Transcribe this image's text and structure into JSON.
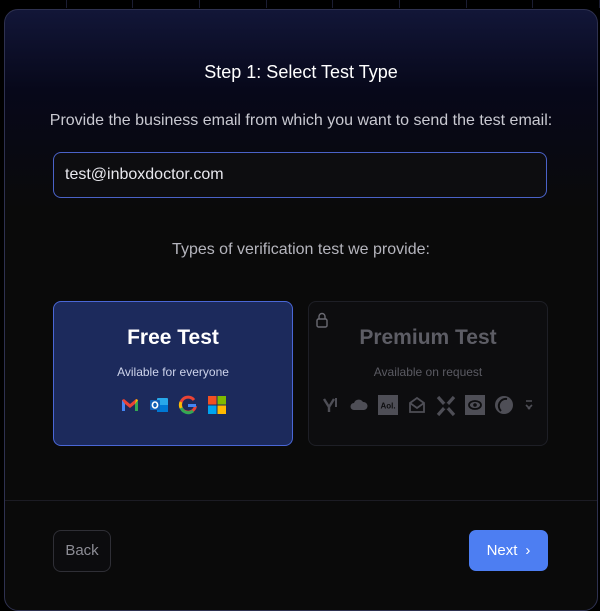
{
  "header": {
    "title": "Step 1: Select Test Type"
  },
  "email": {
    "prompt": "Provide the business email from which you want to send the test email:",
    "value": "test@inboxdoctor.com"
  },
  "test_types": {
    "heading": "Types of verification test we provide:",
    "free": {
      "name": "Free Test",
      "description": "Avilable for everyone",
      "selected": true,
      "providers": [
        "gmail-icon",
        "outlook-icon",
        "google-icon",
        "microsoft-icon"
      ]
    },
    "premium": {
      "name": "Premium Test",
      "description": "Available on request",
      "locked": true,
      "aol_label": "Aol.",
      "providers": [
        "yahoo-icon",
        "icloud-icon",
        "aol-icon",
        "mailbox-icon",
        "x-icon",
        "yandex-icon",
        "opera-icon",
        "other-icon"
      ]
    }
  },
  "footer": {
    "back_label": "Back",
    "next_label": "Next"
  },
  "colors": {
    "accent": "#4d7ef2",
    "selected_card": "#1c2a5c",
    "selected_border": "#4a67d6"
  }
}
